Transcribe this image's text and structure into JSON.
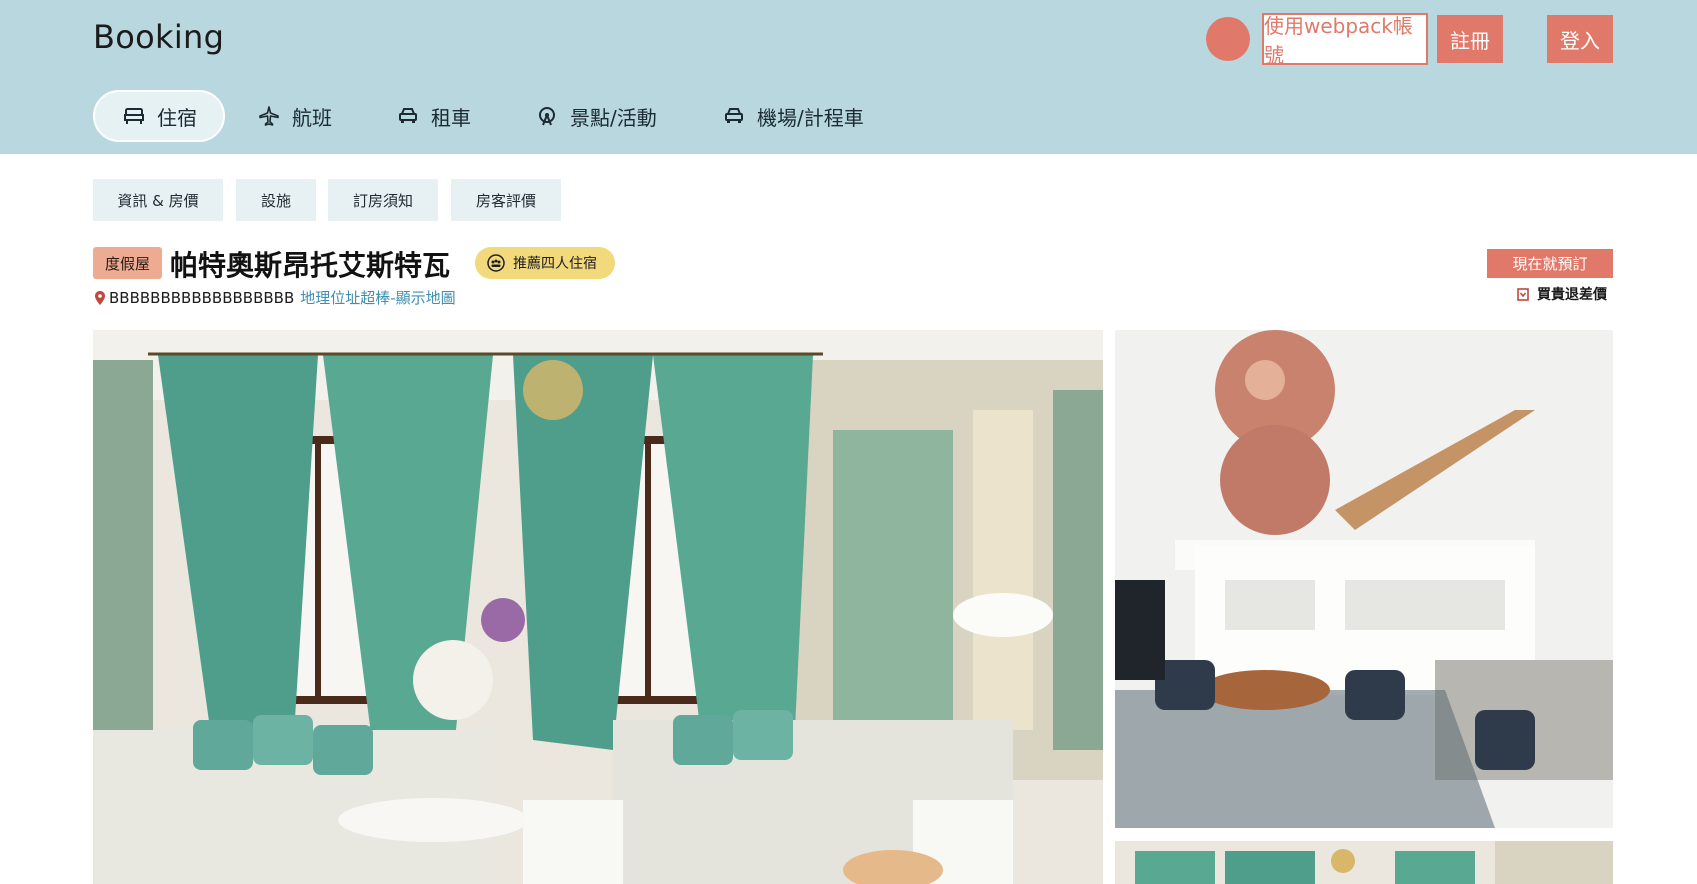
{
  "header": {
    "logo": "Booking",
    "webpack_button": "使用webpack帳號",
    "register_button": "註冊",
    "login_button": "登入"
  },
  "nav": {
    "tabs": [
      {
        "label": "住宿",
        "icon": "bed-icon",
        "active": true
      },
      {
        "label": "航班",
        "icon": "airplane-icon",
        "active": false
      },
      {
        "label": "租車",
        "icon": "car-icon",
        "active": false
      },
      {
        "label": "景點/活動",
        "icon": "ferris-wheel-icon",
        "active": false
      },
      {
        "label": "機場/計程車",
        "icon": "taxi-icon",
        "active": false
      }
    ]
  },
  "subtabs": [
    "資訊 & 房價",
    "設施",
    "訂房須知",
    "房客評價"
  ],
  "property": {
    "type_badge": "度假屋",
    "name": "帕特奧斯昂托艾斯特瓦",
    "recommend_badge": "推薦四人住宿",
    "address": "BBBBBBBBBBBBBBBBBB",
    "map_link": "地理位址超棒-顯示地圖"
  },
  "booking": {
    "book_now_button": "現在就預訂",
    "price_match": "買貴退差價"
  },
  "colors": {
    "header_bg": "#b9d7df",
    "accent": "#e0796a",
    "type_badge": "#eeab93",
    "recommend_badge": "#f2d97c",
    "subtab_bg": "#e7f1f4",
    "link": "#3e8fb0"
  }
}
